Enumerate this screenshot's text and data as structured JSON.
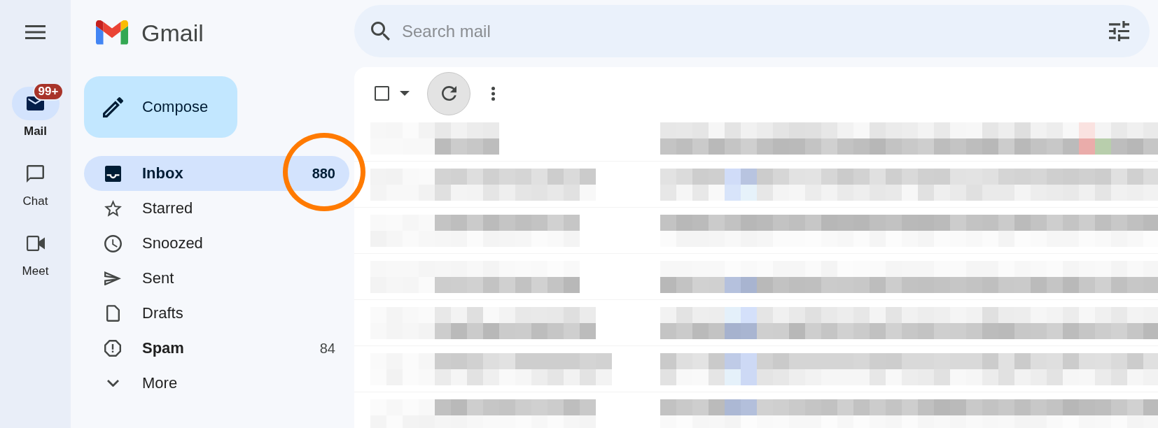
{
  "rail": {
    "items": [
      {
        "label": "Mail",
        "selected": true,
        "badge": "99+"
      },
      {
        "label": "Chat",
        "selected": false
      },
      {
        "label": "Meet",
        "selected": false
      }
    ]
  },
  "logo": {
    "name": "Gmail"
  },
  "compose": {
    "label": "Compose"
  },
  "nav": {
    "items": [
      {
        "label": "Inbox",
        "selected": true,
        "unread": true,
        "count": "880",
        "highlighted": true
      },
      {
        "label": "Starred",
        "selected": false,
        "unread": false,
        "highlighted": false
      },
      {
        "label": "Snoozed",
        "selected": false,
        "unread": false,
        "highlighted": false
      },
      {
        "label": "Sent",
        "selected": false,
        "unread": false,
        "highlighted": false
      },
      {
        "label": "Drafts",
        "selected": false,
        "unread": false,
        "highlighted": false
      },
      {
        "label": "Spam",
        "selected": false,
        "unread": true,
        "count": "84",
        "highlighted": false
      },
      {
        "label": "More",
        "selected": false,
        "unread": false,
        "highlighted": false
      }
    ]
  },
  "search": {
    "placeholder": "Search mail"
  },
  "toolbar": {
    "select_all": {
      "checked": false
    }
  },
  "message_list": {
    "rows": [
      {
        "kind": "pixelated"
      },
      {
        "kind": "pixelated"
      },
      {
        "kind": "pixelated"
      },
      {
        "kind": "pixelated"
      },
      {
        "kind": "pixelated"
      },
      {
        "kind": "pixelated"
      },
      {
        "kind": "pixelated"
      }
    ]
  }
}
